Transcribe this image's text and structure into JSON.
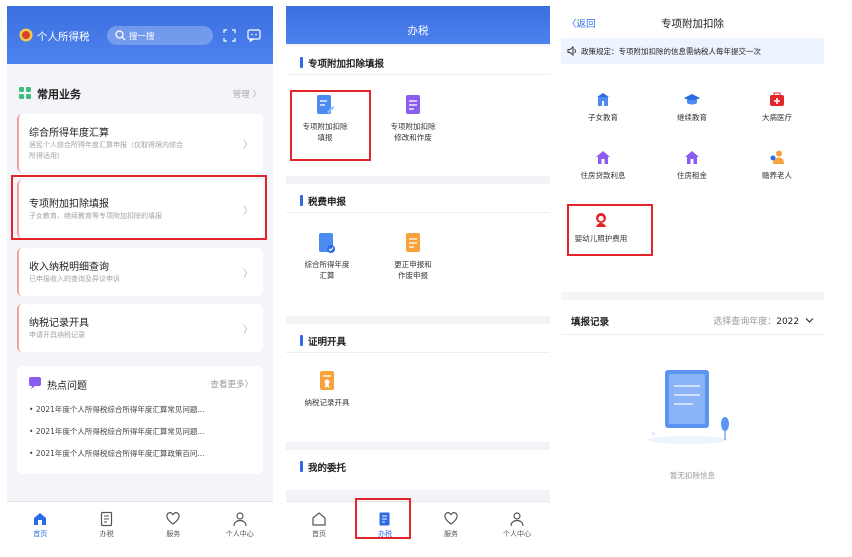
{
  "screen1": {
    "header_title": "个人所得税",
    "search_placeholder": "搜一搜",
    "section_title": "常用业务",
    "manage_label": "管理 〉",
    "services": [
      {
        "title": "综合所得年度汇算",
        "desc1": "居民个人综合所得年度汇算申报（仅取得境内综合",
        "desc2": "所得适用）"
      },
      {
        "title": "专项附加扣除填报",
        "desc1": "子女教育、继续教育等专项附加扣除的填报",
        "desc2": ""
      },
      {
        "title": "收入纳税明细查询",
        "desc1": "已申报收入的查询及异议申诉",
        "desc2": ""
      },
      {
        "title": "纳税记录开具",
        "desc1": "申请开具纳税记录",
        "desc2": ""
      }
    ],
    "hot_title": "热点问题",
    "hot_more": "查看更多〉",
    "hot_items": [
      "2021年度个人所得税综合所得年度汇算常见问题...",
      "2021年度个人所得税综合所得年度汇算常见问题...",
      "2021年度个人所得税综合所得年度汇算政策百问..."
    ],
    "tabs": [
      "首页",
      "办税",
      "服务",
      "个人中心"
    ]
  },
  "screen2": {
    "header_title": "办税",
    "sections": [
      {
        "title": "专项附加扣除填报",
        "tiles": [
          [
            "专项附加扣除",
            "填报"
          ],
          [
            "专项附加扣除",
            "修改和作废"
          ]
        ]
      },
      {
        "title": "税费申报",
        "tiles": [
          [
            "综合所得年度",
            "汇算"
          ],
          [
            "更正申报和",
            "作废申报"
          ]
        ]
      },
      {
        "title": "证明开具",
        "tiles": [
          [
            "纳税记录开具",
            ""
          ]
        ]
      },
      {
        "title": "我的委托",
        "tiles": []
      }
    ],
    "tabs": [
      "首页",
      "办税",
      "服务",
      "个人中心"
    ]
  },
  "screen3": {
    "back_label": "〈返回",
    "title": "专项附加扣除",
    "notice": "政策规定：专项附加扣除的信息需纳税人每年提交一次",
    "categories": [
      "子女教育",
      "继续教育",
      "大病医疗",
      "住房贷款利息",
      "住房租金",
      "赡养老人",
      "婴幼儿照护费用"
    ],
    "record_title": "填报记录",
    "year_label": "选择查询年度：",
    "year_value": "2022",
    "empty_text": "暂无扣除信息"
  },
  "colors": {
    "brand_blue": "#2d6ae6",
    "highlight_red": "#e2252a",
    "green": "#3fbf7f",
    "orange": "#f7a23a"
  }
}
